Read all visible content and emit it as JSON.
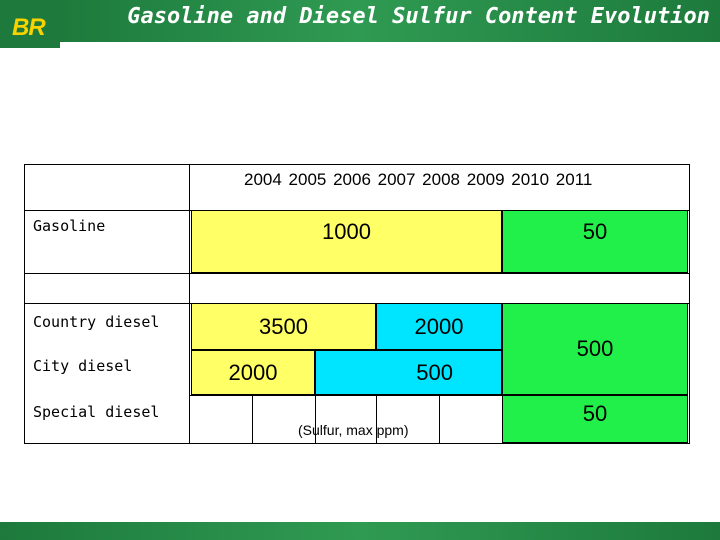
{
  "header": {
    "logo_text": "BR",
    "title": "Gasoline and Diesel Sulfur Content Evolution"
  },
  "table": {
    "years": "2004 2005 2006 2007 2008 2009 2010 2011",
    "unit_note": "(Sulfur, max ppm)",
    "rows": [
      {
        "label": "Gasoline",
        "values": [
          "1000",
          "50"
        ]
      },
      {
        "label": "Country diesel",
        "values": [
          "3500",
          "2000"
        ]
      },
      {
        "label": "City diesel",
        "values": [
          "2000",
          "500"
        ]
      },
      {
        "label": "Special diesel",
        "values": []
      }
    ],
    "diesel_late": {
      "city_country": "500",
      "special": "50"
    }
  },
  "colors": {
    "brand_green": "#1d7a3c",
    "logo_yellow": "#f7d300",
    "yellow": "#ffff66",
    "cyan": "#00e5ff",
    "green": "#22f04a"
  }
}
